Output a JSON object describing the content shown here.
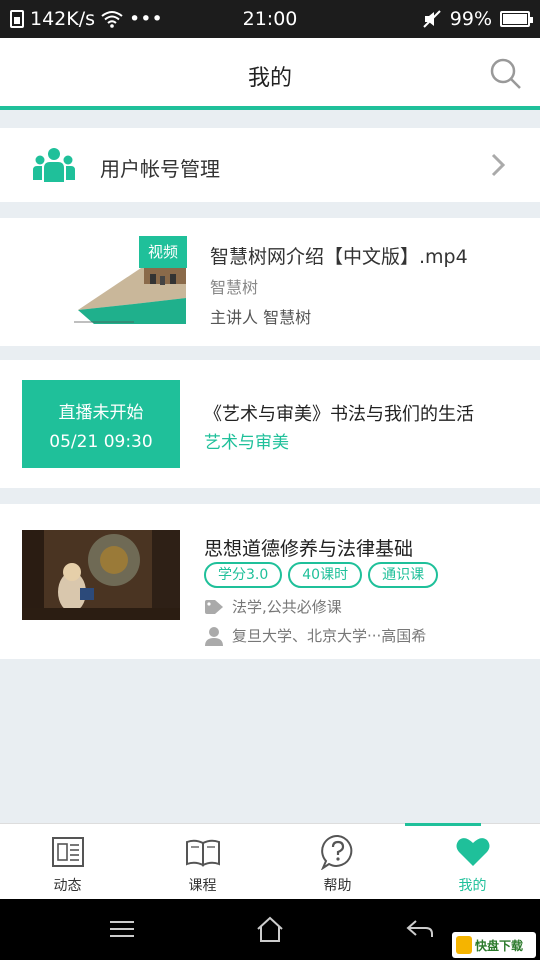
{
  "status_bar": {
    "speed": "142K/s",
    "dots": "•••",
    "time": "21:00",
    "battery": "99%"
  },
  "header": {
    "title": "我的"
  },
  "account": {
    "label": "用户帐号管理"
  },
  "video": {
    "badge": "视频",
    "title": "智慧树网介绍【中文版】.mp4",
    "subtitle": "智慧树",
    "lecturer": "主讲人 智慧树"
  },
  "live": {
    "status": "直播未开始",
    "time": "05/21 09:30",
    "title": "《艺术与审美》书法与我们的生活",
    "category": "艺术与审美"
  },
  "course": {
    "title": "思想道德修养与法律基础",
    "tags": [
      "学分3.0",
      "40课时",
      "通识课"
    ],
    "category": "法学,公共必修课",
    "universities": "复旦大学、北京大学···高国希"
  },
  "tabs": [
    {
      "label": "动态",
      "icon": "news-icon",
      "active": false
    },
    {
      "label": "课程",
      "icon": "book-icon",
      "active": false
    },
    {
      "label": "帮助",
      "icon": "help-icon",
      "active": false
    },
    {
      "label": "我的",
      "icon": "heart-icon",
      "active": true
    }
  ],
  "watermark": {
    "text": "快盘下载"
  },
  "colors": {
    "accent": "#1fc09a",
    "background": "#e9eef2"
  }
}
